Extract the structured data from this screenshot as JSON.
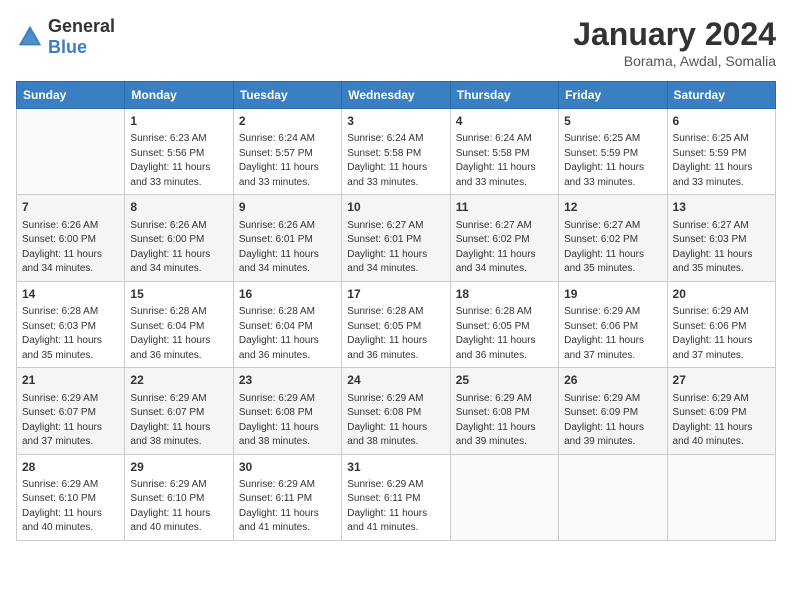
{
  "header": {
    "logo_general": "General",
    "logo_blue": "Blue",
    "month_year": "January 2024",
    "location": "Borama, Awdal, Somalia"
  },
  "days_of_week": [
    "Sunday",
    "Monday",
    "Tuesday",
    "Wednesday",
    "Thursday",
    "Friday",
    "Saturday"
  ],
  "weeks": [
    [
      {
        "day": "",
        "sunrise": "",
        "sunset": "",
        "daylight": ""
      },
      {
        "day": "1",
        "sunrise": "Sunrise: 6:23 AM",
        "sunset": "Sunset: 5:56 PM",
        "daylight": "Daylight: 11 hours and 33 minutes."
      },
      {
        "day": "2",
        "sunrise": "Sunrise: 6:24 AM",
        "sunset": "Sunset: 5:57 PM",
        "daylight": "Daylight: 11 hours and 33 minutes."
      },
      {
        "day": "3",
        "sunrise": "Sunrise: 6:24 AM",
        "sunset": "Sunset: 5:58 PM",
        "daylight": "Daylight: 11 hours and 33 minutes."
      },
      {
        "day": "4",
        "sunrise": "Sunrise: 6:24 AM",
        "sunset": "Sunset: 5:58 PM",
        "daylight": "Daylight: 11 hours and 33 minutes."
      },
      {
        "day": "5",
        "sunrise": "Sunrise: 6:25 AM",
        "sunset": "Sunset: 5:59 PM",
        "daylight": "Daylight: 11 hours and 33 minutes."
      },
      {
        "day": "6",
        "sunrise": "Sunrise: 6:25 AM",
        "sunset": "Sunset: 5:59 PM",
        "daylight": "Daylight: 11 hours and 33 minutes."
      }
    ],
    [
      {
        "day": "7",
        "sunrise": "Sunrise: 6:26 AM",
        "sunset": "Sunset: 6:00 PM",
        "daylight": "Daylight: 11 hours and 34 minutes."
      },
      {
        "day": "8",
        "sunrise": "Sunrise: 6:26 AM",
        "sunset": "Sunset: 6:00 PM",
        "daylight": "Daylight: 11 hours and 34 minutes."
      },
      {
        "day": "9",
        "sunrise": "Sunrise: 6:26 AM",
        "sunset": "Sunset: 6:01 PM",
        "daylight": "Daylight: 11 hours and 34 minutes."
      },
      {
        "day": "10",
        "sunrise": "Sunrise: 6:27 AM",
        "sunset": "Sunset: 6:01 PM",
        "daylight": "Daylight: 11 hours and 34 minutes."
      },
      {
        "day": "11",
        "sunrise": "Sunrise: 6:27 AM",
        "sunset": "Sunset: 6:02 PM",
        "daylight": "Daylight: 11 hours and 34 minutes."
      },
      {
        "day": "12",
        "sunrise": "Sunrise: 6:27 AM",
        "sunset": "Sunset: 6:02 PM",
        "daylight": "Daylight: 11 hours and 35 minutes."
      },
      {
        "day": "13",
        "sunrise": "Sunrise: 6:27 AM",
        "sunset": "Sunset: 6:03 PM",
        "daylight": "Daylight: 11 hours and 35 minutes."
      }
    ],
    [
      {
        "day": "14",
        "sunrise": "Sunrise: 6:28 AM",
        "sunset": "Sunset: 6:03 PM",
        "daylight": "Daylight: 11 hours and 35 minutes."
      },
      {
        "day": "15",
        "sunrise": "Sunrise: 6:28 AM",
        "sunset": "Sunset: 6:04 PM",
        "daylight": "Daylight: 11 hours and 36 minutes."
      },
      {
        "day": "16",
        "sunrise": "Sunrise: 6:28 AM",
        "sunset": "Sunset: 6:04 PM",
        "daylight": "Daylight: 11 hours and 36 minutes."
      },
      {
        "day": "17",
        "sunrise": "Sunrise: 6:28 AM",
        "sunset": "Sunset: 6:05 PM",
        "daylight": "Daylight: 11 hours and 36 minutes."
      },
      {
        "day": "18",
        "sunrise": "Sunrise: 6:28 AM",
        "sunset": "Sunset: 6:05 PM",
        "daylight": "Daylight: 11 hours and 36 minutes."
      },
      {
        "day": "19",
        "sunrise": "Sunrise: 6:29 AM",
        "sunset": "Sunset: 6:06 PM",
        "daylight": "Daylight: 11 hours and 37 minutes."
      },
      {
        "day": "20",
        "sunrise": "Sunrise: 6:29 AM",
        "sunset": "Sunset: 6:06 PM",
        "daylight": "Daylight: 11 hours and 37 minutes."
      }
    ],
    [
      {
        "day": "21",
        "sunrise": "Sunrise: 6:29 AM",
        "sunset": "Sunset: 6:07 PM",
        "daylight": "Daylight: 11 hours and 37 minutes."
      },
      {
        "day": "22",
        "sunrise": "Sunrise: 6:29 AM",
        "sunset": "Sunset: 6:07 PM",
        "daylight": "Daylight: 11 hours and 38 minutes."
      },
      {
        "day": "23",
        "sunrise": "Sunrise: 6:29 AM",
        "sunset": "Sunset: 6:08 PM",
        "daylight": "Daylight: 11 hours and 38 minutes."
      },
      {
        "day": "24",
        "sunrise": "Sunrise: 6:29 AM",
        "sunset": "Sunset: 6:08 PM",
        "daylight": "Daylight: 11 hours and 38 minutes."
      },
      {
        "day": "25",
        "sunrise": "Sunrise: 6:29 AM",
        "sunset": "Sunset: 6:08 PM",
        "daylight": "Daylight: 11 hours and 39 minutes."
      },
      {
        "day": "26",
        "sunrise": "Sunrise: 6:29 AM",
        "sunset": "Sunset: 6:09 PM",
        "daylight": "Daylight: 11 hours and 39 minutes."
      },
      {
        "day": "27",
        "sunrise": "Sunrise: 6:29 AM",
        "sunset": "Sunset: 6:09 PM",
        "daylight": "Daylight: 11 hours and 40 minutes."
      }
    ],
    [
      {
        "day": "28",
        "sunrise": "Sunrise: 6:29 AM",
        "sunset": "Sunset: 6:10 PM",
        "daylight": "Daylight: 11 hours and 40 minutes."
      },
      {
        "day": "29",
        "sunrise": "Sunrise: 6:29 AM",
        "sunset": "Sunset: 6:10 PM",
        "daylight": "Daylight: 11 hours and 40 minutes."
      },
      {
        "day": "30",
        "sunrise": "Sunrise: 6:29 AM",
        "sunset": "Sunset: 6:11 PM",
        "daylight": "Daylight: 11 hours and 41 minutes."
      },
      {
        "day": "31",
        "sunrise": "Sunrise: 6:29 AM",
        "sunset": "Sunset: 6:11 PM",
        "daylight": "Daylight: 11 hours and 41 minutes."
      },
      {
        "day": "",
        "sunrise": "",
        "sunset": "",
        "daylight": ""
      },
      {
        "day": "",
        "sunrise": "",
        "sunset": "",
        "daylight": ""
      },
      {
        "day": "",
        "sunrise": "",
        "sunset": "",
        "daylight": ""
      }
    ]
  ]
}
